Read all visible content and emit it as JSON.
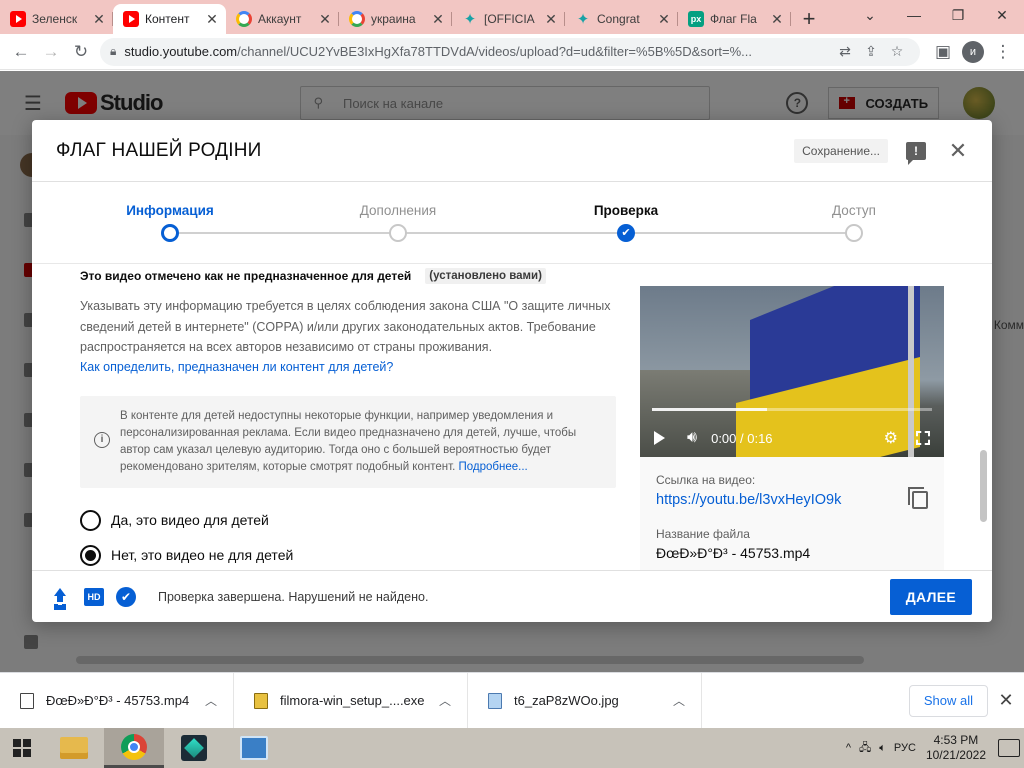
{
  "browser": {
    "tabs": [
      {
        "title": "Зеленск",
        "favicon": "youtube-icon",
        "active": false
      },
      {
        "title": "Контент",
        "favicon": "youtube-icon",
        "active": true
      },
      {
        "title": "Аккаунт",
        "favicon": "google-icon",
        "active": false
      },
      {
        "title": "украина",
        "favicon": "google-icon",
        "active": false
      },
      {
        "title": "[OFFICIA",
        "favicon": "star-icon",
        "active": false
      },
      {
        "title": "Congrat",
        "favicon": "star-icon",
        "active": false
      },
      {
        "title": "Флаг Fla",
        "favicon": "px-icon",
        "active": false
      }
    ],
    "url_host": "studio.youtube.com",
    "url_path": "/channel/UCU2YvBE3IxHgXfa78TTDVdA/videos/upload?d=ud&filter=%5B%5D&sort=%...",
    "profile_initial": "и"
  },
  "studio": {
    "logo_text": "Studio",
    "search_placeholder": "Поиск на канале",
    "create_label": "СОЗДАТЬ",
    "side_text": "Комм"
  },
  "modal": {
    "title": "ФЛАГ НАШЕЙ РОДІНИ",
    "save_status": "Сохранение...",
    "steps": [
      {
        "label": "Информация",
        "state": "current"
      },
      {
        "label": "Дополнения",
        "state": "pending"
      },
      {
        "label": "Проверка",
        "state": "done"
      },
      {
        "label": "Доступ",
        "state": "pending"
      }
    ],
    "kids": {
      "heading": "Это видео отмечено как не предназначенное для детей",
      "tag": "(установлено вами)",
      "description": "Указывать эту информацию требуется в целях соблюдения закона США \"О защите личных сведений детей в интернете\" (COPPA) и/или других законодательных актов. Требование распространяется на всех авторов независимо от страны проживания.",
      "link": "Как определить, предназначен ли контент для детей?",
      "info_text": "В контенте для детей недоступны некоторые функции, например уведомления и персонализированная реклама. Если видео предназначено для детей, лучше, чтобы автор сам указал целевую аудиторию. Тогда оно с большей вероятностью будет рекомендовано зрителям, которые смотрят подобный контент.",
      "info_more": "Подробнее...",
      "option_yes": "Да, это видео для детей",
      "option_no": "Нет, это видео не для детей",
      "selected": "no"
    },
    "video": {
      "time": "0:00 / 0:16",
      "progress": 0.41,
      "link_label": "Ссылка на видео:",
      "link": "https://youtu.be/l3vxHeyIO9k",
      "file_label": "Название файла",
      "file_name": "ÐœÐ»Ð°Ð³ - 45753.mp4"
    },
    "footer": {
      "status": "Проверка завершена. Нарушений не найдено.",
      "next_label": "ДАЛЕЕ"
    }
  },
  "downloads": {
    "items": [
      {
        "name": "ÐœÐ»Ð°Ð³ - 45753.mp4",
        "type": "video"
      },
      {
        "name": "filmora-win_setup_....exe",
        "type": "exe"
      },
      {
        "name": "t6_zaP8zWOo.jpg",
        "type": "image"
      }
    ],
    "show_all": "Show all"
  },
  "taskbar": {
    "lang": "РУС",
    "time": "4:53 PM",
    "date": "10/21/2022"
  },
  "colors": {
    "accent": "#065fd4",
    "tabstrip": "#f2c6c3",
    "yt_red": "#ff0000"
  }
}
